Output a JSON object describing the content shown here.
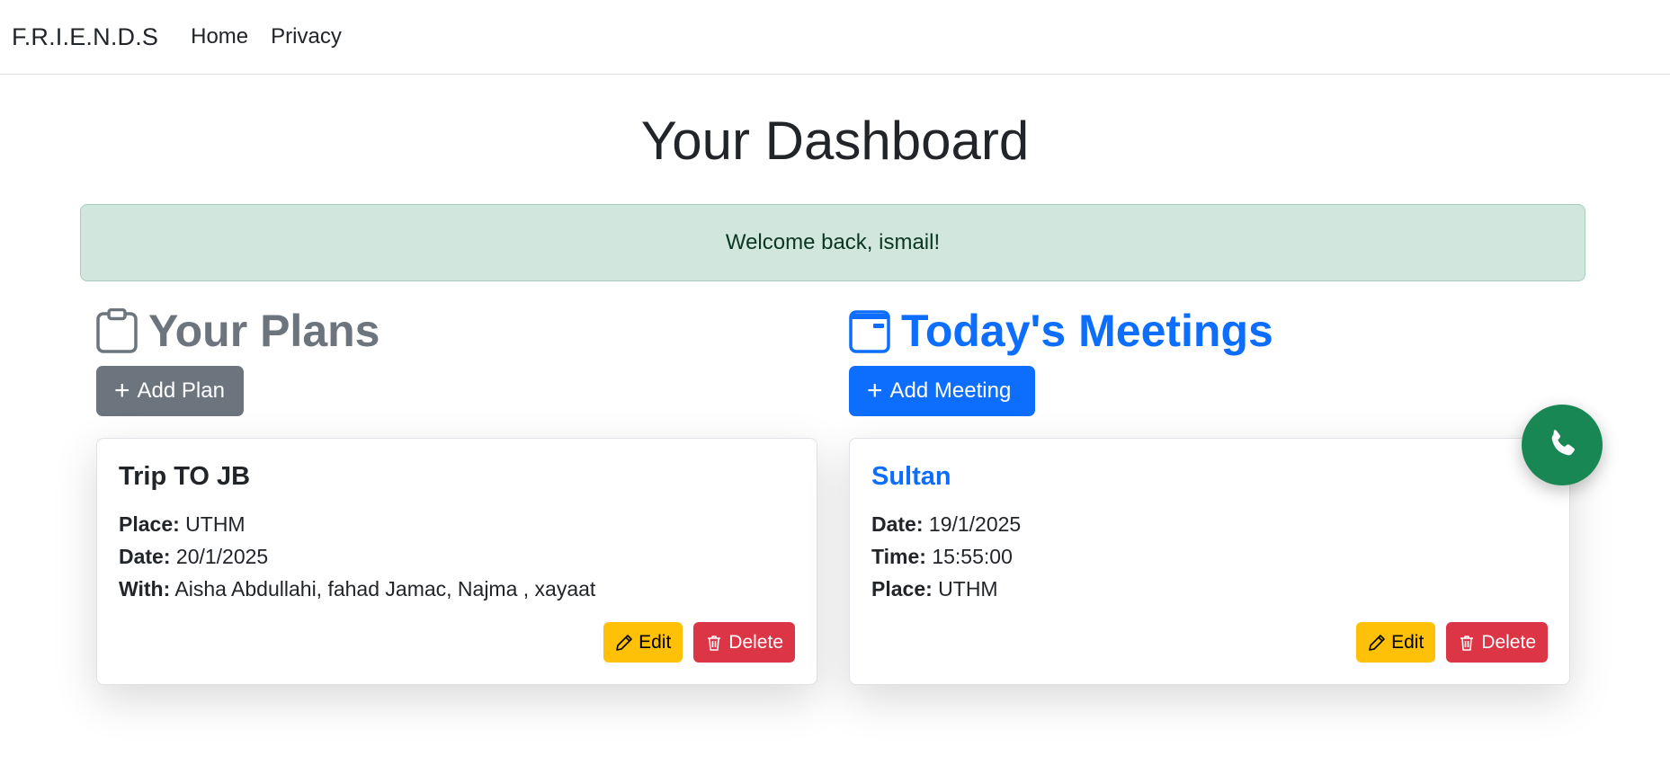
{
  "navbar": {
    "brand": "F.R.I.E.N.D.S",
    "links": [
      "Home",
      "Privacy"
    ]
  },
  "page": {
    "title": "Your Dashboard",
    "alert": "Welcome back, ismail!"
  },
  "plans": {
    "heading": "Your Plans",
    "icon": "clipboard-icon",
    "add_label": "Add Plan",
    "cards": [
      {
        "title": "Trip TO JB",
        "place_label": "Place:",
        "place": "UTHM",
        "date_label": "Date:",
        "date": "20/1/2025",
        "with_label": "With:",
        "with": "Aisha Abdullahi, fahad Jamac, Najma , xayaat",
        "edit_label": "Edit",
        "delete_label": "Delete"
      }
    ]
  },
  "meetings": {
    "heading": "Today's Meetings",
    "icon": "calendar-icon",
    "add_label": "Add Meeting",
    "cards": [
      {
        "title": "Sultan",
        "date_label": "Date:",
        "date": "19/1/2025",
        "time_label": "Time:",
        "time": "15:55:00",
        "place_label": "Place:",
        "place": "UTHM",
        "edit_label": "Edit",
        "delete_label": "Delete"
      }
    ]
  },
  "colors": {
    "primary": "#0d6efd",
    "secondary": "#6c757d",
    "success": "#198754",
    "warning": "#ffc107",
    "danger": "#dc3545",
    "alert_bg": "#d1e7dd"
  },
  "floating": {
    "icon": "phone-icon"
  }
}
